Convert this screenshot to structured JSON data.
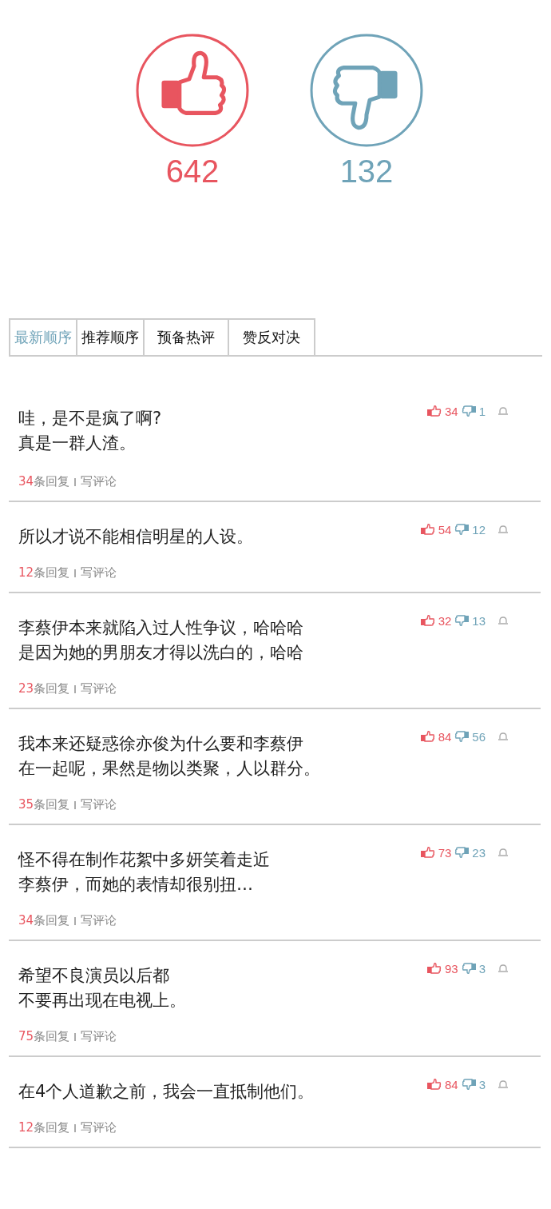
{
  "votes": {
    "up": "642",
    "down": "132"
  },
  "tabs": [
    {
      "label": "最新顺序",
      "selected": true
    },
    {
      "label": "推荐顺序",
      "selected": false
    },
    {
      "label": "预备热评",
      "selected": false
    },
    {
      "label": "赞反对决",
      "selected": false
    }
  ],
  "comments": [
    {
      "lines": [
        "哇，是不是疯了啊?",
        "真是一群人渣。"
      ],
      "likes": "34",
      "dislikes": "1",
      "replies": "34",
      "reply_label": "条回复",
      "write": "写评论"
    },
    {
      "lines": [
        "所以才说不能相信明星的人设。"
      ],
      "likes": "54",
      "dislikes": "12",
      "replies": "12",
      "reply_label": "条回复",
      "write": "写评论"
    },
    {
      "lines": [
        "李蔡伊本来就陷入过人性争议，哈哈哈",
        "是因为她的男朋友才得以洗白的，哈哈"
      ],
      "likes": "32",
      "dislikes": "13",
      "replies": "23",
      "reply_label": "条回复",
      "write": "写评论"
    },
    {
      "lines": [
        "我本来还疑惑徐亦俊为什么要和李蔡伊",
        "在一起呢，果然是物以类聚，人以群分。"
      ],
      "likes": "84",
      "dislikes": "56",
      "replies": "35",
      "reply_label": "条回复",
      "write": "写评论"
    },
    {
      "lines": [
        "怪不得在制作花絮中多妍笑着走近",
        "李蔡伊，而她的表情却很别扭…"
      ],
      "likes": "73",
      "dislikes": "23",
      "replies": "34",
      "reply_label": "条回复",
      "write": "写评论"
    },
    {
      "lines": [
        "希望不良演员以后都",
        "不要再出现在电视上。"
      ],
      "likes": "93",
      "dislikes": "3",
      "replies": "75",
      "reply_label": "条回复",
      "write": "写评论"
    },
    {
      "lines": [
        "在4个人道歉之前，我会一直抵制他们。"
      ],
      "likes": "84",
      "dislikes": "3",
      "replies": "12",
      "reply_label": "条回复",
      "write": "写评论"
    }
  ]
}
